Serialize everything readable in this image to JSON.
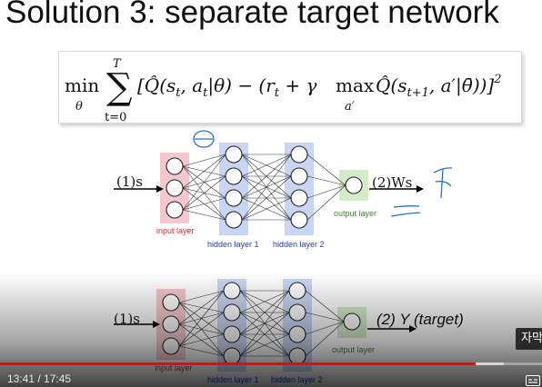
{
  "slide": {
    "title": "Solution 3: separate target network",
    "formula": {
      "min_op": "min",
      "min_sub": "θ",
      "sum_top": "T",
      "sum_bottom": "t=0",
      "sum_symbol": "∑",
      "body": "[Q̂(s",
      "max_op": "max",
      "max_sub": "a′"
    },
    "top_network": {
      "input_label": "(1)s",
      "output_label": "(2)Ws",
      "layer_labels": {
        "input": "input layer",
        "hidden1": "hidden layer 1",
        "hidden2": "hidden layer 2",
        "output": "output layer"
      }
    },
    "bottom_network": {
      "input_label": "(1)s",
      "output_label": "(2) Y (target)",
      "layer_labels": {
        "input": "input layer",
        "hidden1": "hidden layer 1",
        "hidden2": "hidden layer 2",
        "output": "output layer"
      }
    },
    "annotation": {
      "theta_scribble": "θ"
    }
  },
  "player": {
    "time_display": "13:41 / 17:45",
    "subtitle_button": "자막",
    "progress_fraction": 0.878,
    "buffer_fraction": 0.93
  },
  "colors": {
    "input_layer": "#f4c8cc",
    "hidden_layer": "#c9d6f2",
    "output_layer": "#d4ecc8",
    "input_label": "#c0303a",
    "hidden_label": "#2040c0",
    "output_label": "#3a8a2a",
    "scribble": "#2a6fd6",
    "progress": "#ff0000"
  }
}
